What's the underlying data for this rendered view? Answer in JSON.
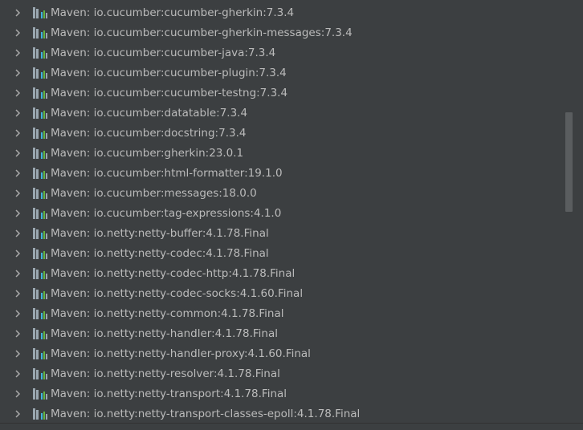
{
  "tree": {
    "items": [
      {
        "prefix": "Maven: ",
        "group": "io.cucumber:",
        "artifact": "cucumber-gherkin:7.3.4"
      },
      {
        "prefix": "Maven: ",
        "group": "io.cucumber:",
        "artifact": "cucumber-gherkin-messages:7.3.4"
      },
      {
        "prefix": "Maven: ",
        "group": "io.cucumber:",
        "artifact": "cucumber-java:7.3.4"
      },
      {
        "prefix": "Maven: ",
        "group": "io.cucumber:",
        "artifact": "cucumber-plugin:7.3.4"
      },
      {
        "prefix": "Maven: ",
        "group": "io.cucumber:",
        "artifact": "cucumber-testng:7.3.4"
      },
      {
        "prefix": "Maven: ",
        "group": "io.cucumber:",
        "artifact": "datatable:7.3.4"
      },
      {
        "prefix": "Maven: ",
        "group": "io.cucumber:",
        "artifact": "docstring:7.3.4"
      },
      {
        "prefix": "Maven: ",
        "group": "io.cucumber:",
        "artifact": "gherkin:23.0.1"
      },
      {
        "prefix": "Maven: ",
        "group": "io.cucumber:",
        "artifact": "html-formatter:19.1.0"
      },
      {
        "prefix": "Maven: ",
        "group": "io.cucumber:",
        "artifact": "messages:18.0.0"
      },
      {
        "prefix": "Maven: ",
        "group": "io.cucumber:",
        "artifact": "tag-expressions:4.1.0"
      },
      {
        "prefix": "Maven: ",
        "group": "io.netty:",
        "artifact": "netty-buffer:4.1.78.Final"
      },
      {
        "prefix": "Maven: ",
        "group": "io.netty:",
        "artifact": "netty-codec:4.1.78.Final"
      },
      {
        "prefix": "Maven: ",
        "group": "io.netty:",
        "artifact": "netty-codec-http:4.1.78.Final"
      },
      {
        "prefix": "Maven: ",
        "group": "io.netty:",
        "artifact": "netty-codec-socks:4.1.60.Final"
      },
      {
        "prefix": "Maven: ",
        "group": "io.netty:",
        "artifact": "netty-common:4.1.78.Final"
      },
      {
        "prefix": "Maven: ",
        "group": "io.netty:",
        "artifact": "netty-handler:4.1.78.Final"
      },
      {
        "prefix": "Maven: ",
        "group": "io.netty:",
        "artifact": "netty-handler-proxy:4.1.60.Final"
      },
      {
        "prefix": "Maven: ",
        "group": "io.netty:",
        "artifact": "netty-resolver:4.1.78.Final"
      },
      {
        "prefix": "Maven: ",
        "group": "io.netty:",
        "artifact": "netty-transport:4.1.78.Final"
      },
      {
        "prefix": "Maven: ",
        "group": "io.netty:",
        "artifact": "netty-transport-classes-epoll:4.1.78.Final"
      }
    ],
    "expand_icon": "chevron-right-icon",
    "item_icon": "library-icon"
  },
  "colors": {
    "background": "#3c3f41",
    "text": "#bbbbbb",
    "chevron": "#a9a9a9",
    "scrollbar": "#5a5d5f"
  }
}
